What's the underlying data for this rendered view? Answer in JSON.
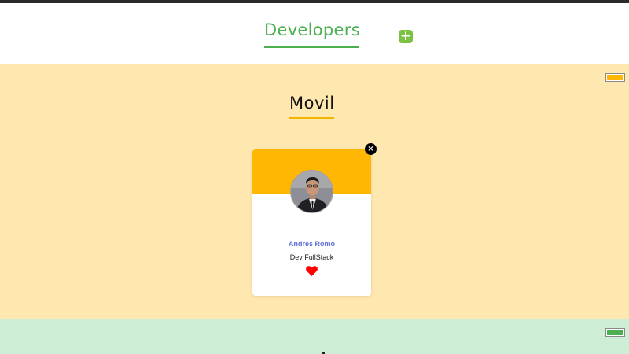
{
  "header": {
    "title": "Developers",
    "add_icon": "plus-square-icon",
    "title_color": "#4caf50"
  },
  "sections": [
    {
      "title": "Movil",
      "background": "#ffe8b0",
      "accent": "#ffb703",
      "cards": [
        {
          "name": "Andres Romo",
          "role": "Dev FullStack",
          "favorite_icon": "heart-icon",
          "remove_icon": "close-icon",
          "banner_color": "#ffb703"
        }
      ]
    },
    {
      "background": "#cdeed4",
      "accent": "#4caf50"
    }
  ],
  "colors": {
    "favorite": "#ff0000",
    "name_text": "#5b6fd6"
  }
}
